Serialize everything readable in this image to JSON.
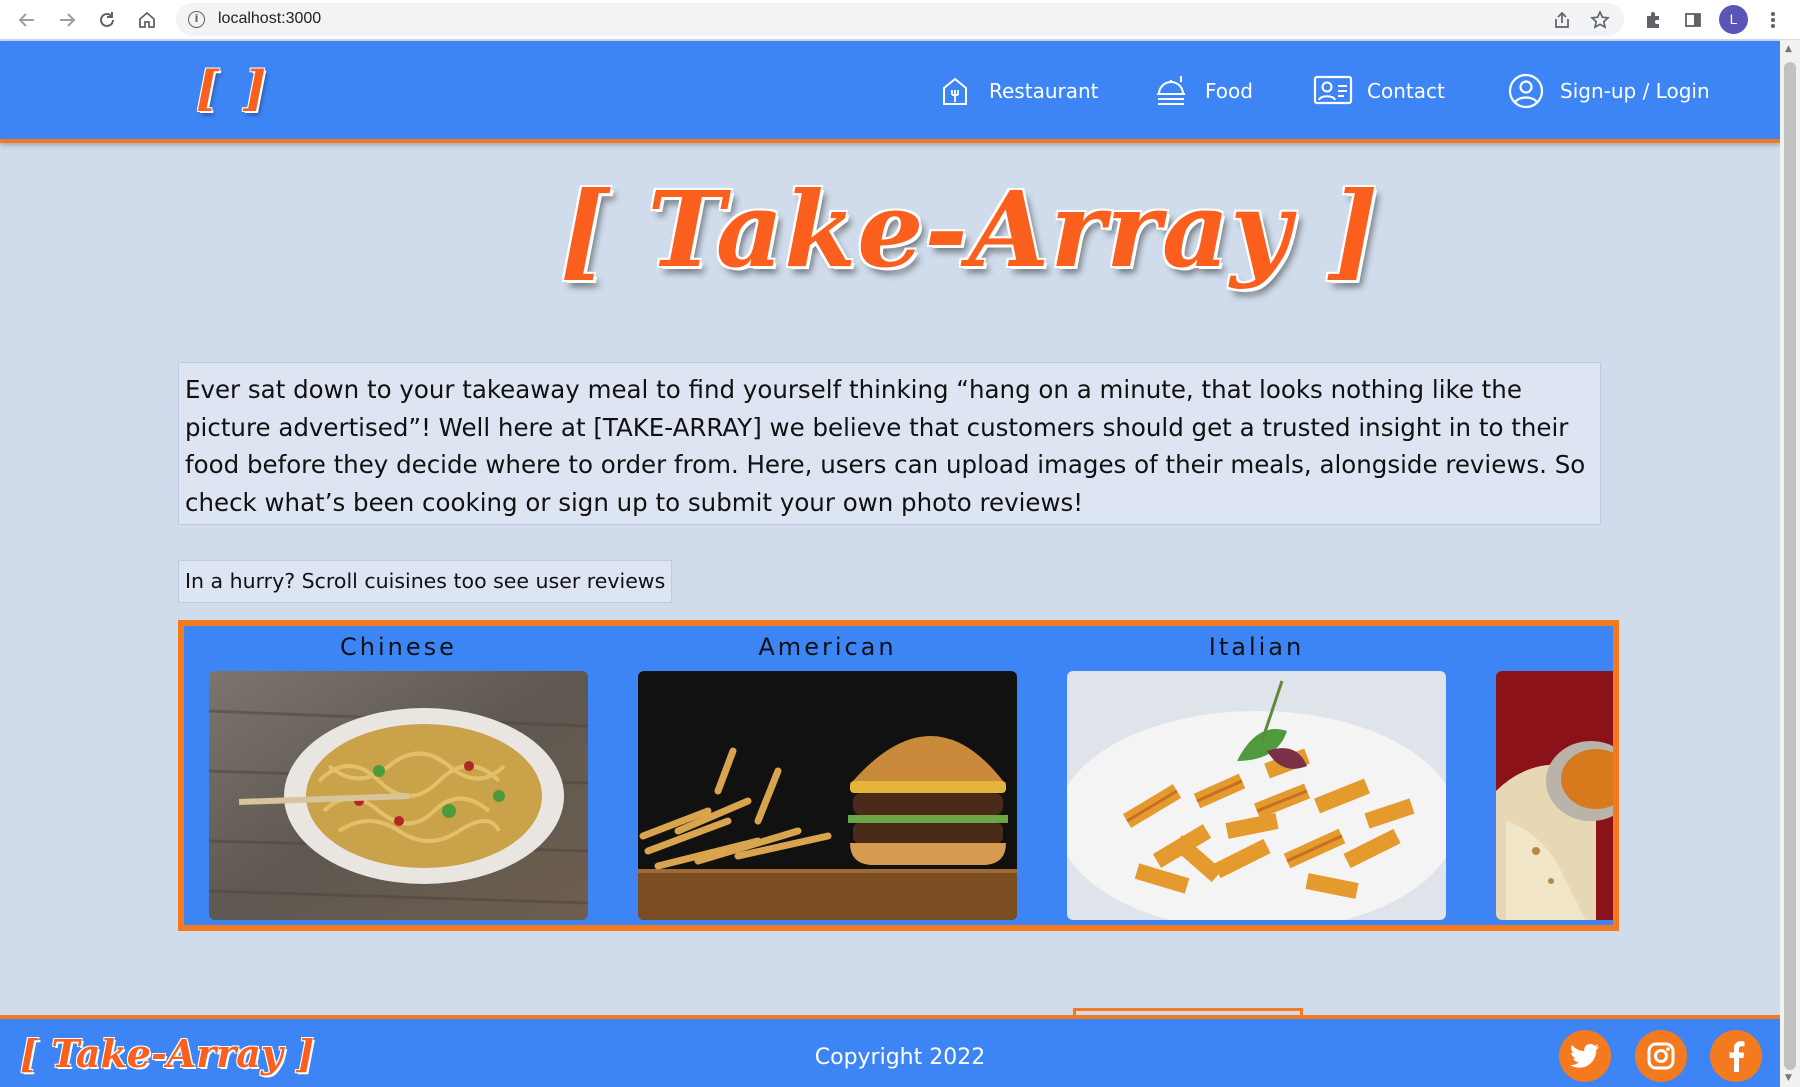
{
  "browser": {
    "url": "localhost:3000",
    "profile_initial": "L",
    "icons": [
      "back-arrow-icon",
      "forward-arrow-icon",
      "reload-icon",
      "home-icon",
      "info-icon",
      "share-icon",
      "star-icon",
      "extensions-icon",
      "side-panel-icon",
      "menu-dots-icon"
    ]
  },
  "header": {
    "logo_text": "[ ]",
    "nav": [
      {
        "label": "Restaurant",
        "icon": "restaurant-icon"
      },
      {
        "label": "Food",
        "icon": "food-icon"
      },
      {
        "label": "Contact",
        "icon": "contact-icon"
      },
      {
        "label": "Sign-up / Login",
        "icon": "user-icon"
      }
    ]
  },
  "hero": {
    "title": "[ Take-Array ]"
  },
  "intro": {
    "text": "Ever sat down to your takeaway meal to find yourself thinking “hang on a minute, that looks nothing like the picture advertised”! Well here at [TAKE-ARRAY] we believe that customers should get a trusted insight in to their food before they decide where to order from. Here, users can upload images of their meals, alongside reviews. So check what’s been cooking or sign up to submit your own photo reviews!"
  },
  "hurry": {
    "text": "In a hurry? Scroll cuisines too see user reviews"
  },
  "cuisines": [
    {
      "title": "Chinese",
      "image": "noodles-photo"
    },
    {
      "title": "American",
      "image": "burger-photo"
    },
    {
      "title": "Italian",
      "image": "pasta-photo"
    },
    {
      "title": "",
      "image": "indian-photo"
    }
  ],
  "footer": {
    "logo_text": "[ Take-Array ]",
    "copyright": "Copyright 2022",
    "social": [
      "twitter-icon",
      "instagram-icon",
      "facebook-icon"
    ]
  },
  "colors": {
    "brand_blue": "#3d85f5",
    "accent_orange": "#f47a20",
    "logo_orange": "#fb5f1d",
    "page_bg": "#d0dceb"
  }
}
